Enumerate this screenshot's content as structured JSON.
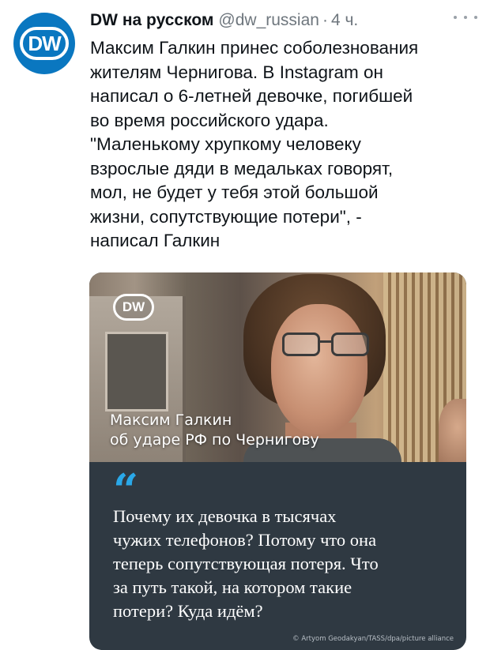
{
  "tweet": {
    "avatar_text": "DW",
    "author_name": "DW на русском",
    "handle": "@dw_russian",
    "separator": "·",
    "time": "4 ч.",
    "text_lines": [
      "Максим Галкин принес соболезнования",
      "жителям Чернигова. В Instagram он",
      "написал о 6-летней девочке, погибшей",
      "во время российского удара.",
      "\"Маленькому хрупкому человеку",
      "взрослые дяди в медальках говорят,",
      "мол, не будет у тебя этой большой",
      "жизни, сопутствующие потери\", -",
      "написал Галкин"
    ]
  },
  "card": {
    "logo_text": "DW",
    "caption_name": "Максим Галкин",
    "caption_sub": "об ударе РФ по Чернигову",
    "quote_mark": "“",
    "quote_lines": [
      "Почему их девочка в тысячах",
      "чужих телефонов? Потому что она",
      "теперь сопутствующая потеря. Что",
      "за путь такой, на котором такие",
      "потери? Куда идём?"
    ],
    "credit": "© Artyom Geodakyan/TASS/dpa/picture alliance"
  },
  "icons": {
    "more": "more-horizontal-icon",
    "quote": "quote-icon"
  },
  "colors": {
    "avatar_bg": "#0a77c0",
    "card_bg": "#2f3942",
    "quote_mark": "#2aa8e8",
    "muted_text": "#6e767d"
  }
}
